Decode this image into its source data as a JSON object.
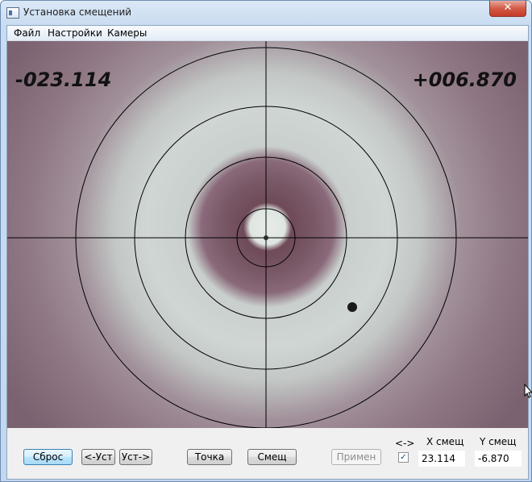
{
  "window": {
    "title": "Установка смещений",
    "close_glyph": "✕"
  },
  "menu": {
    "items": [
      "Файл",
      "Настройки",
      "Камеры"
    ]
  },
  "camera": {
    "x_readout": "-023.114",
    "y_readout": "+006.870"
  },
  "buttons": {
    "reset": "Сброс",
    "set_left": "<-Уст",
    "set_right": "Уст->",
    "point": "Точка",
    "offset": "Смещ",
    "apply": "Примен"
  },
  "swap": {
    "label": "<->",
    "checked": true,
    "check_glyph": "✓"
  },
  "offsets": {
    "x_label": "X смещ",
    "y_label": "Y смещ",
    "x_value": "23.114",
    "y_value": "-6.870"
  }
}
